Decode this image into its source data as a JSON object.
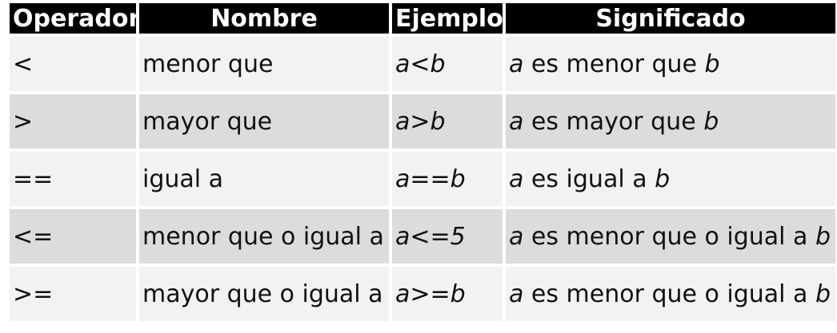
{
  "headers": {
    "operator": "Operador",
    "name": "Nombre",
    "example": "Ejemplo",
    "meaning": "Significado"
  },
  "rows": [
    {
      "operator": "<",
      "name": "menor que",
      "example": "a<b",
      "meaning": {
        "var1": "a",
        "text": " es menor que ",
        "var2": "b"
      }
    },
    {
      "operator": ">",
      "name": "mayor que",
      "example": "a>b",
      "meaning": {
        "var1": "a",
        "text": " es mayor que ",
        "var2": "b"
      }
    },
    {
      "operator": "==",
      "name": "igual a",
      "example": "a==b",
      "meaning": {
        "var1": "a",
        "text": " es igual a ",
        "var2": "b"
      }
    },
    {
      "operator": "<=",
      "name": "menor que o igual a",
      "example": "a<=5",
      "meaning": {
        "var1": "a",
        "text": " es menor que o igual a ",
        "var2": "b"
      }
    },
    {
      "operator": ">=",
      "name": "mayor que o igual a",
      "example": "a>=b",
      "meaning": {
        "var1": "a",
        "text": " es menor que o igual a ",
        "var2": "b"
      }
    }
  ]
}
